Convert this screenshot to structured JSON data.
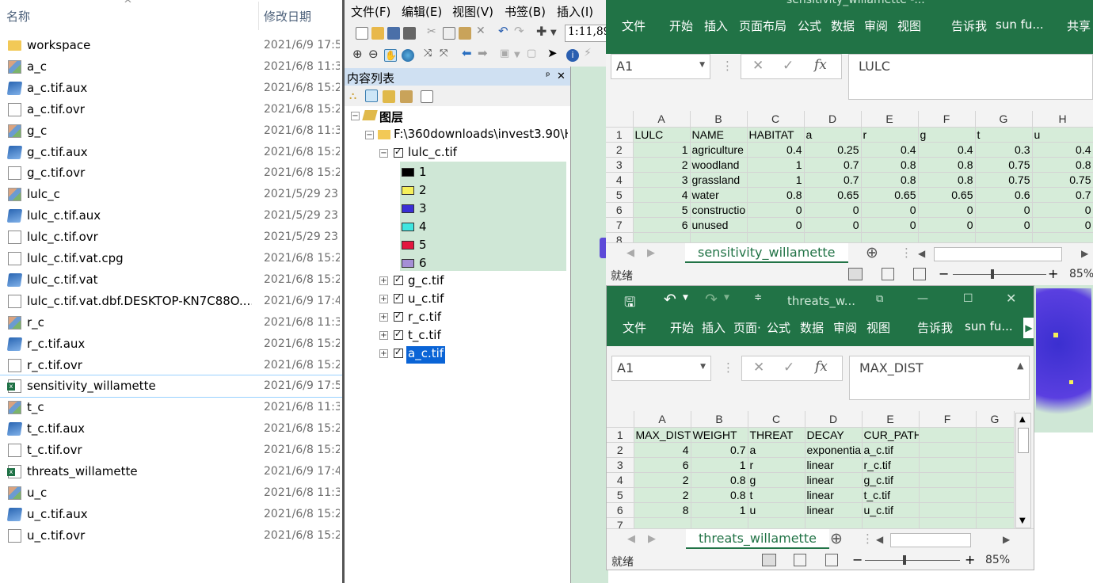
{
  "explorer": {
    "col_name": "名称",
    "col_date": "修改日期",
    "files": [
      {
        "name": "workspace",
        "date": "2021/6/9 17:5",
        "icon": "folder-icon"
      },
      {
        "name": "a_c",
        "date": "2021/6/8 11:3",
        "icon": "raster-image-icon"
      },
      {
        "name": "a_c.tif.aux",
        "date": "2021/6/8 15:2",
        "icon": "aux-file-icon"
      },
      {
        "name": "a_c.tif.ovr",
        "date": "2021/6/8 15:2",
        "icon": "blank-file-icon"
      },
      {
        "name": "g_c",
        "date": "2021/6/8 11:3",
        "icon": "raster-image-icon"
      },
      {
        "name": "g_c.tif.aux",
        "date": "2021/6/8 15:2",
        "icon": "aux-file-icon"
      },
      {
        "name": "g_c.tif.ovr",
        "date": "2021/6/8 15:2",
        "icon": "blank-file-icon"
      },
      {
        "name": "lulc_c",
        "date": "2021/5/29 23",
        "icon": "raster-image-icon"
      },
      {
        "name": "lulc_c.tif.aux",
        "date": "2021/5/29 23",
        "icon": "aux-file-icon"
      },
      {
        "name": "lulc_c.tif.ovr",
        "date": "2021/5/29 23",
        "icon": "blank-file-icon"
      },
      {
        "name": "lulc_c.tif.vat.cpg",
        "date": "2021/6/8 15:2",
        "icon": "blank-file-icon"
      },
      {
        "name": "lulc_c.tif.vat",
        "date": "2021/6/8 15:2",
        "icon": "aux-file-icon"
      },
      {
        "name": "lulc_c.tif.vat.dbf.DESKTOP-KN7C88O....",
        "date": "2021/6/9 17:4",
        "icon": "blank-file-icon"
      },
      {
        "name": "r_c",
        "date": "2021/6/8 11:3",
        "icon": "raster-image-icon"
      },
      {
        "name": "r_c.tif.aux",
        "date": "2021/6/8 15:2",
        "icon": "aux-file-icon"
      },
      {
        "name": "r_c.tif.ovr",
        "date": "2021/6/8 15:2",
        "icon": "blank-file-icon"
      },
      {
        "name": "sensitivity_willamette",
        "date": "2021/6/9 17:5",
        "icon": "excel-file-icon"
      },
      {
        "name": "t_c",
        "date": "2021/6/8 11:3",
        "icon": "raster-image-icon"
      },
      {
        "name": "t_c.tif.aux",
        "date": "2021/6/8 15:2",
        "icon": "aux-file-icon"
      },
      {
        "name": "t_c.tif.ovr",
        "date": "2021/6/8 15:2",
        "icon": "blank-file-icon"
      },
      {
        "name": "threats_willamette",
        "date": "2021/6/9 17:4",
        "icon": "excel-file-icon"
      },
      {
        "name": "u_c",
        "date": "2021/6/8 11:3",
        "icon": "raster-image-icon"
      },
      {
        "name": "u_c.tif.aux",
        "date": "2021/6/8 15:2",
        "icon": "aux-file-icon"
      },
      {
        "name": "u_c.tif.ovr",
        "date": "2021/6/8 15:2",
        "icon": "blank-file-icon"
      }
    ]
  },
  "arcmap": {
    "menu": [
      "文件(F)",
      "编辑(E)",
      "视图(V)",
      "书签(B)",
      "插入(I)"
    ],
    "scale": "1:11,89",
    "toc_title": "内容列表",
    "pin": "ᵖ",
    "close": "✕",
    "layers_label": "图层",
    "folder_path": "F:\\360downloads\\invest3.90\\H",
    "layer_lulc": "lulc_c.tif",
    "legend": [
      {
        "label": "1",
        "color": "#000000"
      },
      {
        "label": "2",
        "color": "#f5f05a"
      },
      {
        "label": "3",
        "color": "#3a2fd6"
      },
      {
        "label": "4",
        "color": "#3fe6e0"
      },
      {
        "label": "5",
        "color": "#e3173f"
      },
      {
        "label": "6",
        "color": "#a58fd6"
      }
    ],
    "layers": [
      "g_c.tif",
      "u_c.tif",
      "r_c.tif",
      "t_c.tif",
      "a_c.tif"
    ]
  },
  "excel1": {
    "title": "sensitivity_willamette -...",
    "tabs": [
      "文件",
      "开始",
      "插入",
      "页面布局",
      "公式",
      "数据",
      "审阅",
      "视图",
      "告诉我",
      "sun fu...",
      "共享"
    ],
    "namebox": "A1",
    "formula": "LULC",
    "cols": [
      "",
      "A",
      "B",
      "C",
      "D",
      "E",
      "F",
      "G",
      "H"
    ],
    "rows": [
      [
        "1",
        "LULC",
        "NAME",
        "HABITAT",
        "a",
        "r",
        "g",
        "t",
        "u"
      ],
      [
        "2",
        "1",
        "agriculture",
        "0.4",
        "0.25",
        "0.4",
        "0.4",
        "0.3",
        "0.4"
      ],
      [
        "3",
        "2",
        "woodland",
        "1",
        "0.7",
        "0.8",
        "0.8",
        "0.75",
        "0.8"
      ],
      [
        "4",
        "3",
        "grassland",
        "1",
        "0.7",
        "0.8",
        "0.8",
        "0.75",
        "0.75"
      ],
      [
        "5",
        "4",
        "water",
        "0.8",
        "0.65",
        "0.65",
        "0.65",
        "0.6",
        "0.7"
      ],
      [
        "6",
        "5",
        "constructio",
        "0",
        "0",
        "0",
        "0",
        "0",
        "0"
      ],
      [
        "7",
        "6",
        "unused",
        "0",
        "0",
        "0",
        "0",
        "0",
        "0"
      ],
      [
        "8",
        "",
        "",
        "",
        "",
        "",
        "",
        "",
        ""
      ]
    ],
    "sheet": "sensitivity_willamette",
    "status": "就绪",
    "zoom": "85%"
  },
  "excel2": {
    "title": "threats_w...",
    "tabs": [
      "文件",
      "开始",
      "插入",
      "页面·",
      "公式",
      "数据",
      "审阅",
      "视图",
      "告诉我",
      "sun fu..."
    ],
    "namebox": "A1",
    "formula": "MAX_DIST",
    "cols": [
      "",
      "A",
      "B",
      "C",
      "D",
      "E",
      "F",
      "G"
    ],
    "rows": [
      [
        "1",
        "MAX_DIST",
        "WEIGHT",
        "THREAT",
        "DECAY",
        "CUR_PATH",
        "",
        ""
      ],
      [
        "2",
        "4",
        "0.7",
        "a",
        "exponentia",
        "a_c.tif",
        "",
        ""
      ],
      [
        "3",
        "6",
        "1",
        "r",
        "linear",
        "r_c.tif",
        "",
        ""
      ],
      [
        "4",
        "2",
        "0.8",
        "g",
        "linear",
        "g_c.tif",
        "",
        ""
      ],
      [
        "5",
        "2",
        "0.8",
        "t",
        "linear",
        "t_c.tif",
        "",
        ""
      ],
      [
        "6",
        "8",
        "1",
        "u",
        "linear",
        "u_c.tif",
        "",
        ""
      ],
      [
        "7",
        "",
        "",
        "",
        "",
        "",
        "",
        ""
      ]
    ],
    "sheet": "threats_willamette",
    "status": "就绪",
    "zoom": "85%"
  }
}
